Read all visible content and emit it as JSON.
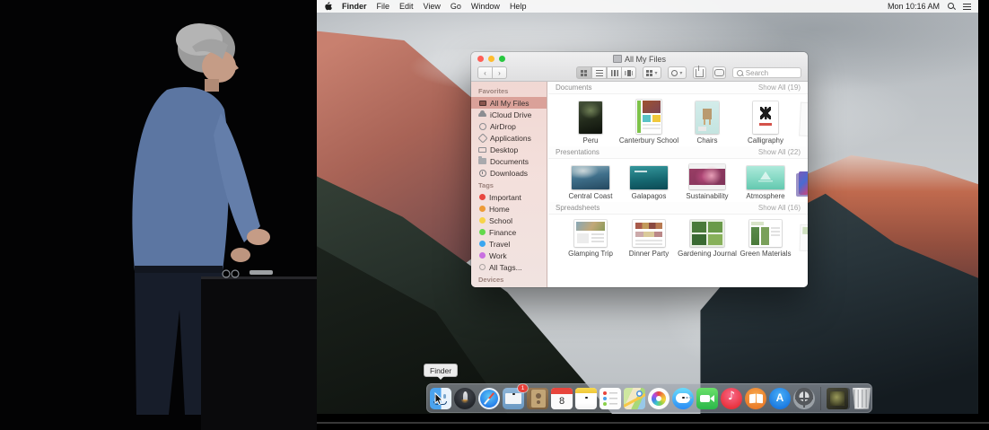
{
  "menu_bar": {
    "items": [
      "Finder",
      "File",
      "Edit",
      "View",
      "Go",
      "Window",
      "Help"
    ],
    "clock": "Mon 10:16 AM"
  },
  "window": {
    "title": "All My Files",
    "search_placeholder": "Search",
    "colors": {
      "close": "#ff5f57",
      "minimize": "#febc2e",
      "zoom": "#28c840",
      "sidebar_selection": "#c77368"
    },
    "sidebar": {
      "favorites_header": "Favorites",
      "favorites": [
        "All My Files",
        "iCloud Drive",
        "AirDrop",
        "Applications",
        "Desktop",
        "Documents",
        "Downloads"
      ],
      "selected_favorite": "All My Files",
      "tags_header": "Tags",
      "tags": [
        {
          "label": "Important",
          "color": "#e8473f"
        },
        {
          "label": "Home",
          "color": "#ed9a37"
        },
        {
          "label": "School",
          "color": "#f7d348"
        },
        {
          "label": "Finance",
          "color": "#63d94c"
        },
        {
          "label": "Travel",
          "color": "#3aa6f0"
        },
        {
          "label": "Work",
          "color": "#c96fe0"
        },
        {
          "label": "All Tags...",
          "color": "transparent"
        }
      ],
      "devices_header": "Devices"
    },
    "sections": [
      {
        "title": "Documents",
        "show_all": "Show All (19)",
        "items": [
          "Peru",
          "Canterbury School",
          "Chairs",
          "Calligraphy"
        ],
        "calligraphy_glyph": "永"
      },
      {
        "title": "Presentations",
        "show_all": "Show All (22)",
        "items": [
          "Central Coast",
          "Galapagos",
          "Sustainability",
          "Atmosphere"
        ]
      },
      {
        "title": "Spreadsheets",
        "show_all": "Show All (16)",
        "items": [
          "Glamping Trip",
          "Dinner Party",
          "Gardening Journal",
          "Green Materials"
        ]
      }
    ]
  },
  "dock": {
    "tooltip": "Finder",
    "mail_badge": "1",
    "calendar_day": "8",
    "itunes_glyph": "♪",
    "appstore_glyph": "A",
    "apps": [
      "finder",
      "launchpad",
      "safari",
      "mail",
      "contacts",
      "calendar",
      "notes",
      "reminders",
      "maps",
      "photos",
      "messages",
      "facetime",
      "itunes",
      "ibooks",
      "app-store",
      "system-preferences",
      "downloads-stack",
      "trash"
    ]
  }
}
